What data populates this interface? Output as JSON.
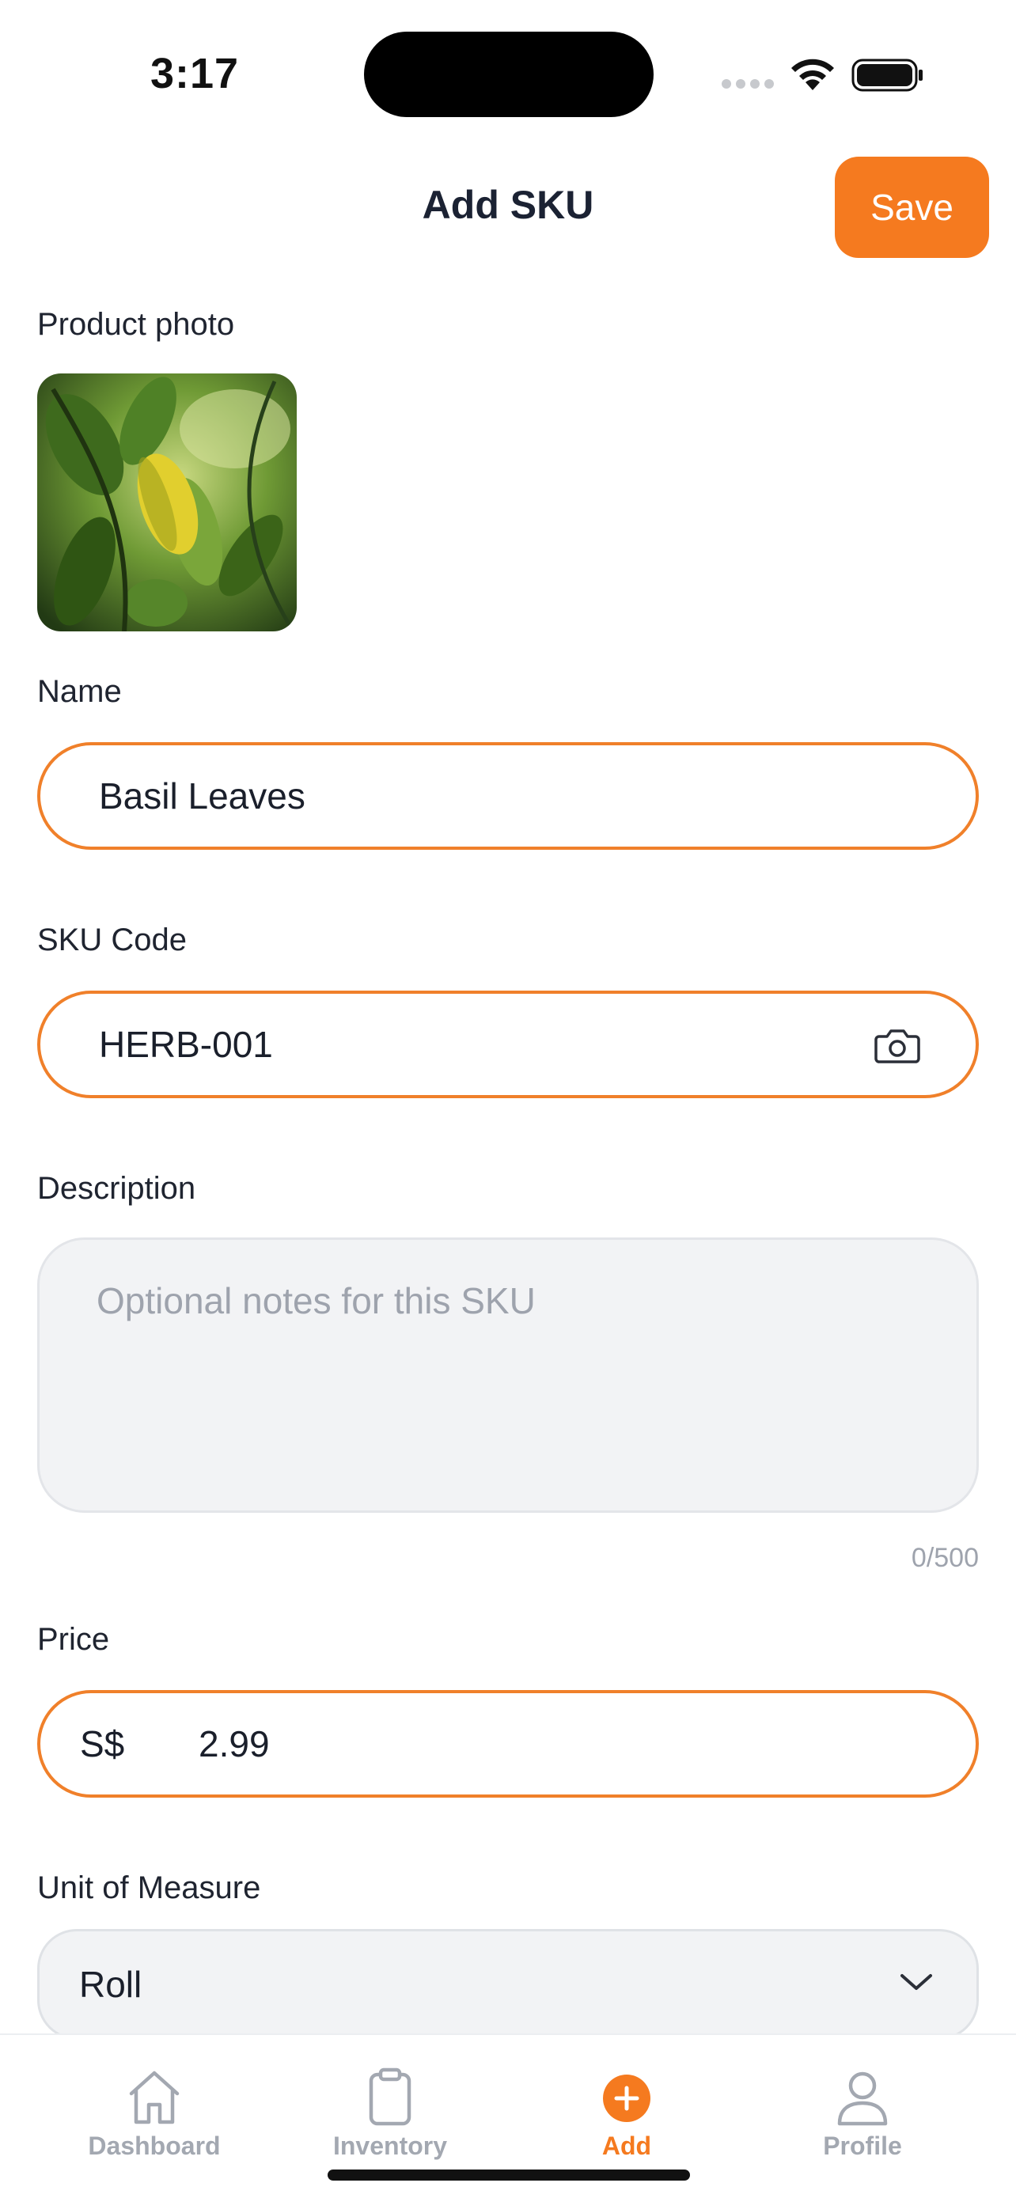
{
  "status_bar": {
    "time": "3:17"
  },
  "header": {
    "title": "Add SKU",
    "save_label": "Save"
  },
  "form": {
    "photo_label": "Product photo",
    "name": {
      "label": "Name",
      "value": "Basil Leaves"
    },
    "sku_code": {
      "label": "SKU Code",
      "value": "HERB-001"
    },
    "description": {
      "label": "Description",
      "placeholder": "Optional notes for this SKU",
      "char_count": "0/500"
    },
    "price": {
      "label": "Price",
      "currency": "S$",
      "value": "2.99"
    },
    "unit": {
      "label": "Unit of Measure",
      "selected": "Roll"
    }
  },
  "tab_bar": {
    "tabs": [
      {
        "label": "Dashboard",
        "icon": "home-icon",
        "active": false
      },
      {
        "label": "Inventory",
        "icon": "clipboard-icon",
        "active": false
      },
      {
        "label": "Add",
        "icon": "plus-circle-icon",
        "active": true
      },
      {
        "label": "Profile",
        "icon": "person-icon",
        "active": false
      }
    ]
  },
  "colors": {
    "accent": "#f57a1f",
    "input_border": "#f0802a",
    "muted": "#a3a8b1"
  }
}
